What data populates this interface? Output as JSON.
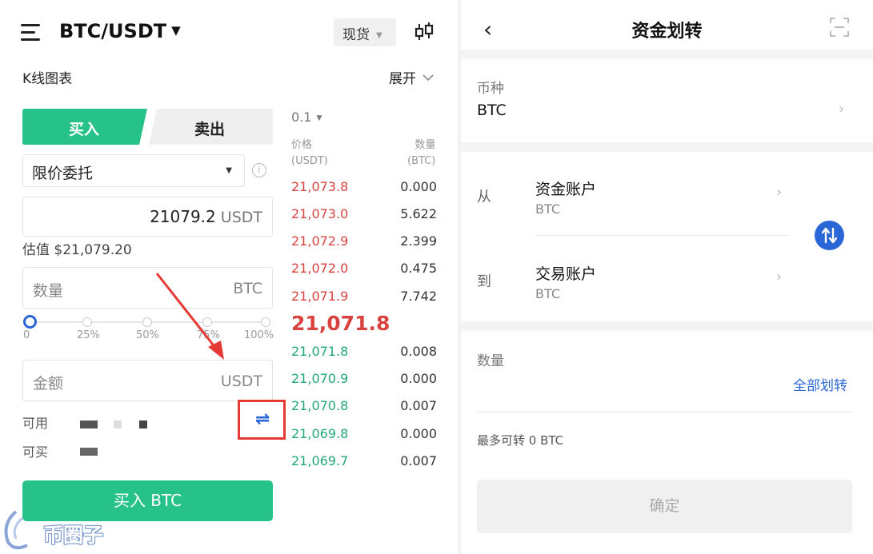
{
  "left": {
    "header": {
      "pair": "BTC/USDT",
      "market_type": "现货"
    },
    "kline": {
      "label": "K线图表",
      "expand_label": "展开"
    },
    "tabs": {
      "buy": "买入",
      "sell": "卖出"
    },
    "order_type": "限价委托",
    "price": {
      "value": "21079.2",
      "unit": "USDT"
    },
    "estimate": "估值 $21,079.20",
    "quantity": {
      "placeholder": "数量",
      "unit": "BTC"
    },
    "slider": {
      "level": 0,
      "labels": [
        "0",
        "25%",
        "50%",
        "75%",
        "100%"
      ]
    },
    "amount": {
      "placeholder": "金额",
      "unit": "USDT"
    },
    "available_label": "可用",
    "can_buy_label": "可买",
    "transfer_icon": "⇌",
    "buy_button": "买入 BTC",
    "order_book": {
      "depth": "0.1",
      "price_header": [
        "价格",
        "(USDT)"
      ],
      "qty_header": [
        "数量",
        "(BTC)"
      ],
      "asks": [
        {
          "price": "21,073.8",
          "qty": "0.000"
        },
        {
          "price": "21,073.0",
          "qty": "5.622"
        },
        {
          "price": "21,072.9",
          "qty": "2.399"
        },
        {
          "price": "21,072.0",
          "qty": "0.475"
        },
        {
          "price": "21,071.9",
          "qty": "7.742"
        }
      ],
      "last_price": "21,071.8",
      "bids": [
        {
          "price": "21,071.8",
          "qty": "0.008"
        },
        {
          "price": "21,070.9",
          "qty": "0.000"
        },
        {
          "price": "21,070.8",
          "qty": "0.007"
        },
        {
          "price": "21,069.8",
          "qty": "0.000"
        },
        {
          "price": "21,069.7",
          "qty": "0.007"
        }
      ]
    },
    "watermark": "币圈子"
  },
  "right": {
    "back_icon": "‹",
    "title": "资金划转",
    "coin": {
      "label": "币种",
      "value": "BTC"
    },
    "from": {
      "label": "从",
      "account": "资金账户",
      "coin": "BTC"
    },
    "to": {
      "label": "到",
      "account": "交易账户",
      "coin": "BTC"
    },
    "quantity": {
      "label": "数量",
      "transfer_all": "全部划转"
    },
    "max_transferable": "最多可转 0 BTC",
    "confirm": "确定",
    "chevron": "›"
  },
  "colors": {
    "buy_green": "#26c28a",
    "ask_red": "#d8433f",
    "bid_green": "#22a877",
    "accent_blue": "#2a66d6",
    "highlight_red": "#e53935"
  }
}
